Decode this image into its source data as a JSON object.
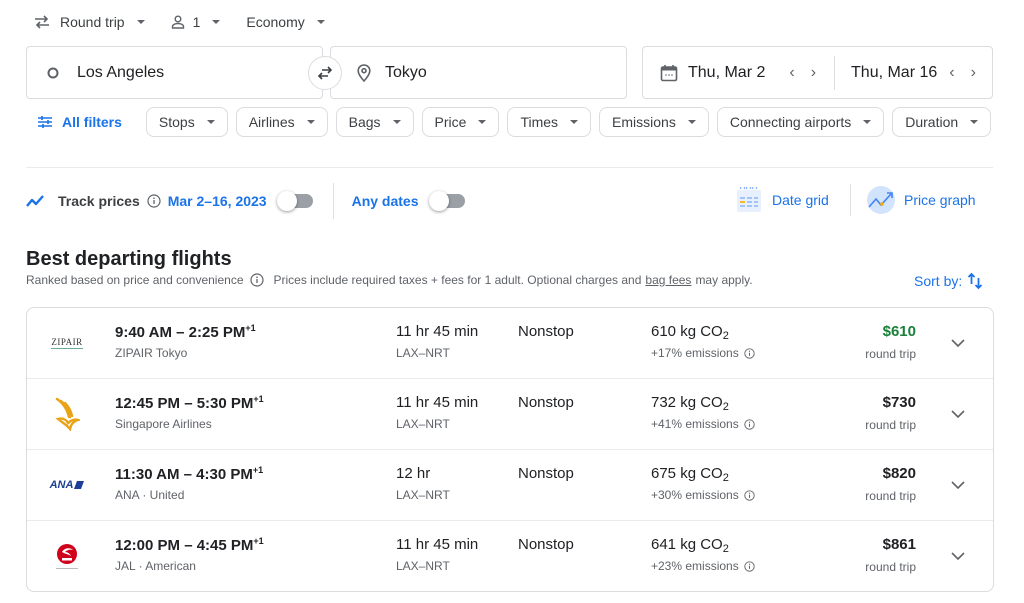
{
  "top_bar": {
    "trip_type": "Round trip",
    "passengers": "1",
    "cabin": "Economy"
  },
  "search": {
    "origin": "Los Angeles",
    "destination": "Tokyo",
    "depart_date": "Thu, Mar 2",
    "return_date": "Thu, Mar 16"
  },
  "filters": {
    "all_filters_label": "All filters",
    "chips": [
      "Stops",
      "Airlines",
      "Bags",
      "Price",
      "Times",
      "Emissions",
      "Connecting airports",
      "Duration"
    ]
  },
  "tracking": {
    "track_prices_label": "Track prices",
    "date_range": "Mar 2–16, 2023",
    "date_range_toggle_on": false,
    "any_dates_label": "Any dates",
    "any_dates_toggle_on": false,
    "date_grid_label": "Date grid",
    "price_graph_label": "Price graph"
  },
  "results_header": {
    "title": "Best departing flights",
    "ranked_note": "Ranked based on price and convenience",
    "prices_note_pre": "Prices include required taxes + fees for 1 adult. Optional charges and",
    "bag_fees_link": "bag fees",
    "prices_note_post": "may apply.",
    "sort_by_label": "Sort by:"
  },
  "flights": [
    {
      "airline_logo": "zipair-logo",
      "logo_text": "ZIPAIR",
      "times": "9:40 AM – 2:25 PM",
      "day_offset": "+1",
      "airline": "ZIPAIR Tokyo",
      "duration": "11 hr 45 min",
      "route": "LAX–NRT",
      "stops": "Nonstop",
      "co2_value": "610 kg CO",
      "co2_sub": "2",
      "emissions": "+17% emissions",
      "price": "$610",
      "price_highlight": true,
      "price_type": "round trip"
    },
    {
      "airline_logo": "singapore-airlines-logo",
      "logo_text": "",
      "times": "12:45 PM – 5:30 PM",
      "day_offset": "+1",
      "airline": "Singapore Airlines",
      "duration": "11 hr 45 min",
      "route": "LAX–NRT",
      "stops": "Nonstop",
      "co2_value": "732 kg CO",
      "co2_sub": "2",
      "emissions": "+41% emissions",
      "price": "$730",
      "price_highlight": false,
      "price_type": "round trip"
    },
    {
      "airline_logo": "ana-logo",
      "logo_text": "ANA",
      "times": "11:30 AM – 4:30 PM",
      "day_offset": "+1",
      "airline": "ANA · United",
      "duration": "12 hr",
      "route": "LAX–NRT",
      "stops": "Nonstop",
      "co2_value": "675 kg CO",
      "co2_sub": "2",
      "emissions": "+30% emissions",
      "price": "$820",
      "price_highlight": false,
      "price_type": "round trip"
    },
    {
      "airline_logo": "jal-logo",
      "logo_text": "JAL",
      "times": "12:00 PM – 4:45 PM",
      "day_offset": "+1",
      "airline": "JAL · American",
      "duration": "11 hr 45 min",
      "route": "LAX–NRT",
      "stops": "Nonstop",
      "co2_value": "641 kg CO",
      "co2_sub": "2",
      "emissions": "+23% emissions",
      "price": "$861",
      "price_highlight": false,
      "price_type": "round trip"
    }
  ],
  "colors": {
    "accent_blue": "#1a73e8",
    "price_green": "#188038",
    "text_primary": "#202124",
    "text_secondary": "#5f6368",
    "border": "#dadce0"
  }
}
